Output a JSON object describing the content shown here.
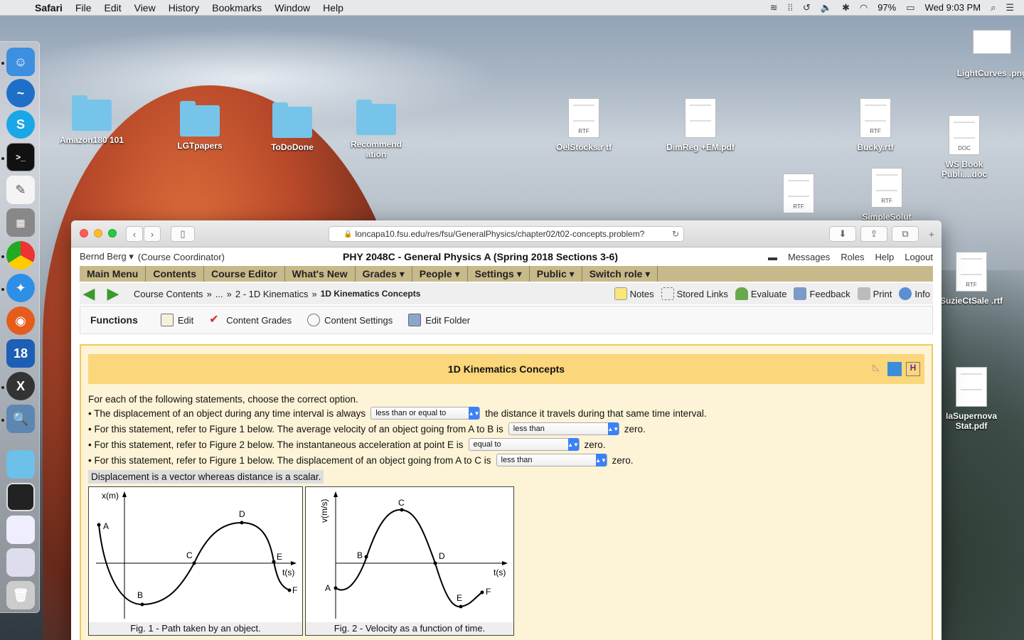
{
  "menubar": {
    "app": "Safari",
    "items": [
      "File",
      "Edit",
      "View",
      "History",
      "Bookmarks",
      "Window",
      "Help"
    ],
    "battery": "97%",
    "clock": "Wed 9:03 PM"
  },
  "desktop": {
    "icons": [
      {
        "label": "Amazon180 101",
        "type": "folder"
      },
      {
        "label": "LGTpapers",
        "type": "folder"
      },
      {
        "label": "ToDoDone",
        "type": "folder"
      },
      {
        "label": "Recommend ation",
        "type": "folder"
      },
      {
        "label": "OelStocks.r tf",
        "type": "RTF"
      },
      {
        "label": "DimReg +EM.pdf",
        "type": "PDF"
      },
      {
        "label": "Bucky.rtf",
        "type": "RTF"
      },
      {
        "label": "LightCurves .png",
        "type": "PNG"
      },
      {
        "label": "WS Book Publi....doc",
        "type": "DOC"
      },
      {
        "label": "SimpleSolut",
        "type": "RTF"
      },
      {
        "label": "",
        "type": "RTF"
      },
      {
        "label": "SuzieCtSale .rtf",
        "type": "RTF"
      },
      {
        "label": "IaSupernova Stat.pdf",
        "type": "PDF"
      }
    ],
    "doc_badges": {
      "rtf": "RTF",
      "doc": "DOC"
    }
  },
  "browser": {
    "url": "loncapa10.fsu.edu/res/fsu/GeneralPhysics/chapter02/t02-concepts.problem?"
  },
  "page": {
    "user": "Bernd Berg ▾",
    "role": "(Course Coordinator)",
    "course_title": "PHY 2048C - General Physics A (Spring 2018 Sections 3-6)",
    "top_links": [
      "Messages",
      "Roles",
      "Help",
      "Logout"
    ],
    "nav": [
      "Main Menu",
      "Contents",
      "Course Editor",
      "What's New",
      "Grades ▾",
      "People ▾",
      "Settings ▾",
      "Public ▾",
      "Switch role ▾"
    ],
    "breadcrumb": {
      "root": "Course Contents",
      "sep": "»",
      "ellipsis": "...",
      "parent": "2 - 1D Kinematics",
      "current": "1D Kinematics Concepts"
    },
    "tools": [
      "Notes",
      "Stored Links",
      "Evaluate",
      "Feedback",
      "Print",
      "Info"
    ],
    "functions": {
      "title": "Functions",
      "items": [
        "Edit",
        "Content Grades",
        "Content Settings",
        "Edit Folder"
      ]
    },
    "problem": {
      "title": "1D Kinematics Concepts",
      "intro": "For each of the following statements, choose the correct option.",
      "q1_pre": "• The displacement of an object during any time interval is always",
      "q1_sel": "less than or equal to",
      "q1_post": "the distance it travels during that same time interval.",
      "q2_pre": "• For this statement, refer to Figure 1 below. The average velocity of an object going from A to B is",
      "q2_sel": "less than",
      "q2_post": "zero.",
      "q3_pre": "• For this statement, refer to Figure 2 below. The instantaneous acceleration at point E is",
      "q3_sel": "equal to",
      "q3_post": "zero.",
      "q4_pre": "• For this statement, refer to Figure 1 below. The displacement of an object going from A to C is",
      "q4_sel": "less than",
      "q4_post": "zero.",
      "feedback": "Displacement is a vector whereas distance is a scalar.",
      "fig1": {
        "ylabel": "x(m)",
        "xlabel": "t(s)",
        "caption": "Fig. 1 - Path taken by an object.",
        "points": [
          "A",
          "B",
          "C",
          "D",
          "E",
          "F"
        ]
      },
      "fig2": {
        "ylabel": "v(m/s)",
        "xlabel": "t(s)",
        "caption": "Fig. 2 - Velocity as a function of time.",
        "points": [
          "A",
          "B",
          "C",
          "D",
          "E",
          "F"
        ]
      }
    }
  }
}
